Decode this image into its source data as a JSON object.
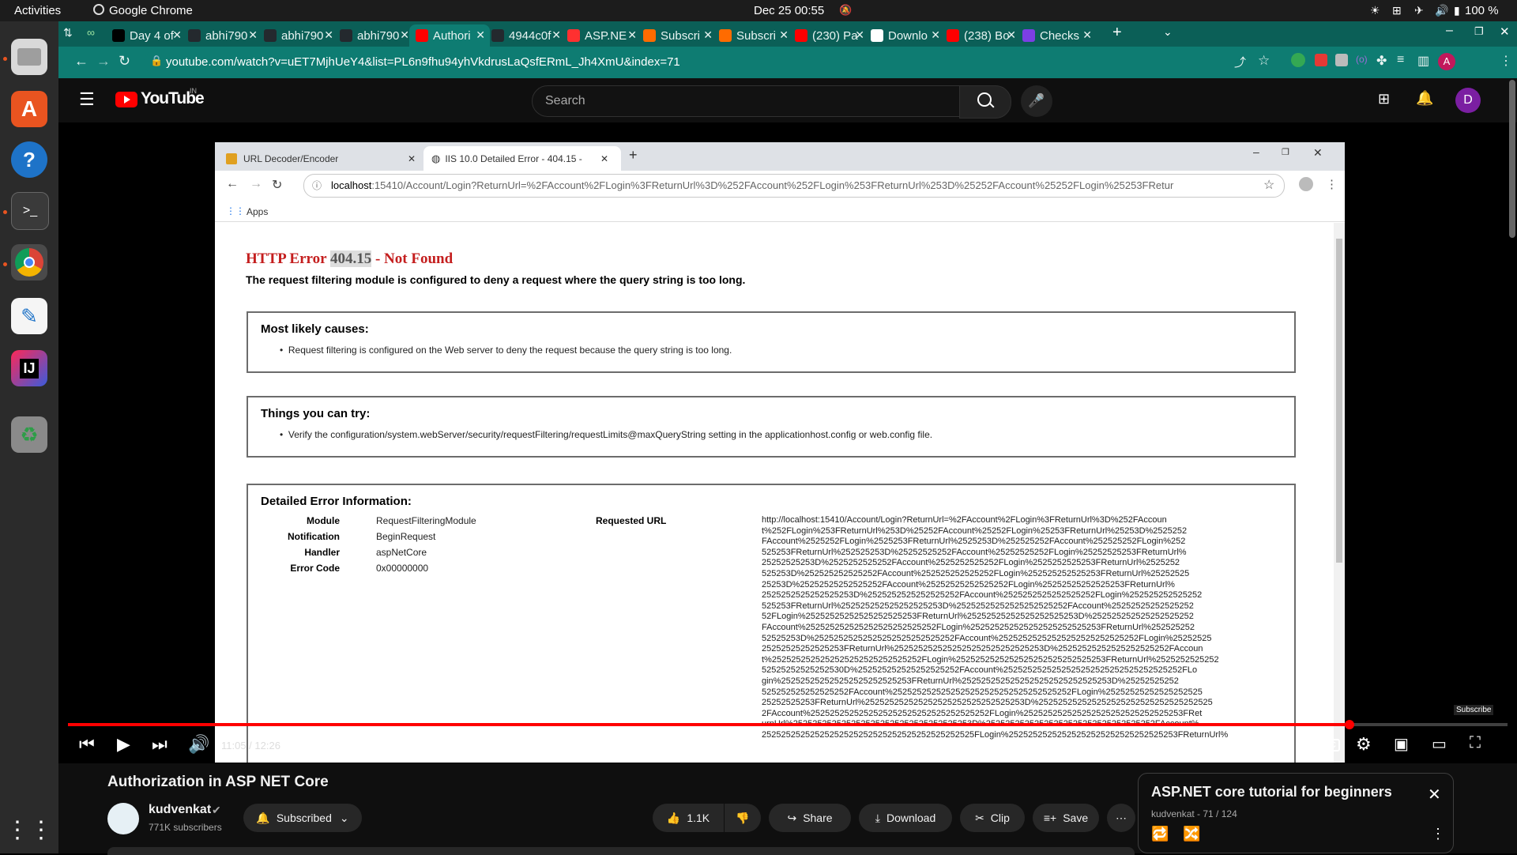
{
  "topbar": {
    "activities": "Activities",
    "app": "Google Chrome",
    "datetime": "Dec 25  00:55",
    "battery": "100 %"
  },
  "chrome": {
    "tabs": [
      {
        "label": "Day 4 of",
        "icon": "medium-icon",
        "color": "#000000"
      },
      {
        "label": "abhi790",
        "icon": "github-icon",
        "color": "#24292e"
      },
      {
        "label": "abhi790",
        "icon": "github-icon",
        "color": "#24292e"
      },
      {
        "label": "abhi790",
        "icon": "github-icon",
        "color": "#24292e"
      },
      {
        "label": "Authori",
        "icon": "youtube-icon",
        "color": "#ff0000",
        "active": true
      },
      {
        "label": "4944c0f",
        "icon": "github-icon",
        "color": "#24292e"
      },
      {
        "label": "ASP.NE",
        "icon": "dot-icon",
        "color": "#ff3030"
      },
      {
        "label": "Subscri",
        "icon": "loading-icon",
        "color": "#ff6b00"
      },
      {
        "label": "Subscri",
        "icon": "loading-icon",
        "color": "#ff6b00"
      },
      {
        "label": "(230) Pa",
        "icon": "youtube-icon",
        "color": "#ff0000"
      },
      {
        "label": "Downlo",
        "icon": "download-icon",
        "color": "#ffffff"
      },
      {
        "label": "(238) Bo",
        "icon": "youtube-icon",
        "color": "#ff0000"
      },
      {
        "label": "Checks",
        "icon": "letter-b-icon",
        "color": "#7b3fe4"
      }
    ],
    "url": "youtube.com/watch?v=uET7MjhUeY4&list=PL6n9fhu94yhVkdrusLaQsfERmL_Jh4XmU&index=71",
    "accent": "#0e7c72",
    "profile_letter": "A"
  },
  "youtube": {
    "logo": "YouTube",
    "region": "IN",
    "search_placeholder": "Search",
    "avatar_letter": "D",
    "video_title": "Authorization in ASP NET Core",
    "channel": "kudvenkat",
    "subscribers": "771K subscribers",
    "subscribed_label": "Subscribed",
    "likes": "1.1K",
    "share": "Share",
    "download": "Download",
    "clip": "Clip",
    "save": "Save",
    "time": "11:05 / 12:26",
    "progress": 0.89,
    "subscribe_watermark": "Subscribe",
    "playlist_title": "ASP.NET core tutorial for beginners",
    "playlist_meta": "kudvenkat - 71 / 124"
  },
  "inner": {
    "tab1": "URL Decoder/Encoder",
    "tab2": "IIS 10.0 Detailed Error - 404.15 -",
    "url_host": "localhost",
    "url_rest": ":15410/Account/Login?ReturnUrl=%2FAccount%2FLogin%3FReturnUrl%3D%252FAccount%252FLogin%253FReturnUrl%253D%25252FAccount%25252FLogin%25253FRetur",
    "apps": "Apps",
    "error_prefix": "HTTP Error ",
    "error_code": "404.15",
    "error_suffix": " - Not Found",
    "error_desc": "The request filtering module is configured to deny a request where the query string is too long.",
    "causes_title": "Most likely causes:",
    "causes_item": "Request filtering is configured on the Web server to deny the request because the query string is too long.",
    "try_title": "Things you can try:",
    "try_item": "Verify the configuration/system.webServer/security/requestFiltering/requestLimits@maxQueryString setting in the applicationhost.config or web.config file.",
    "detail_title": "Detailed Error Information:",
    "details": [
      {
        "k": "Module",
        "v": "RequestFilteringModule"
      },
      {
        "k": "Notification",
        "v": "BeginRequest"
      },
      {
        "k": "Handler",
        "v": "aspNetCore"
      },
      {
        "k": "Error Code",
        "v": "0x00000000"
      }
    ],
    "requested_url_label": "Requested URL",
    "requested_url_lines": [
      "http://localhost:15410/Account/Login?ReturnUrl=%2FAccount%2FLogin%3FReturnUrl%3D%252FAccoun",
      "t%252FLogin%253FReturnUrl%253D%25252FAccount%25252FLogin%25253FReturnUrl%25253D%2525252",
      "FAccount%2525252FLogin%2525253FReturnUrl%2525253D%252525252FAccount%252525252FLogin%252",
      "525253FReturnUrl%252525253D%25252525252FAccount%25252525252FLogin%25252525253FReturnUrl%",
      "25252525253D%2525252525252FAccount%2525252525252FLogin%2525252525253FReturnUrl%2525252",
      "525253D%252525252525252FAccount%252525252525252FLogin%252525252525253FReturnUrl%25252525",
      "25253D%25252525252525252FAccount%25252525252525252FLogin%25252525252525253FReturnUrl%",
      "2525252525252525253D%2525252525252525252FAccount%2525252525252525252FLogin%252525252525252",
      "525253FReturnUrl%252525252525252525253D%25252525252525252525252FAccount%25252525252525252",
      "52FLogin%25252525252525252525253FReturnUrl%25252525252525252525253D%252525252525252525252",
      "FAccount%252525252525252525252525252FLogin%252525252525252525252525253FReturnUrl%252525252",
      "52525253D%25252525252525252525252525252FAccount%25252525252525252525252525252FLogin%25252525",
      "25252525252525253FReturnUrl%2525252525252525252525252525253D%25252525252525252525252FAccoun",
      "t%2525252525252525252525252525252FLogin%2525252525252525252525252525253FReturnUrl%2525252525252",
      "52525252525252530D%252525252525252525252FAccount%2525252525252525252525252525252525252FLo",
      "gin%252525252525252525252525253FReturnUrl%2525252525252525252525252525253D%25252525252",
      "525252525252525252FAccount%2525252525252525252525252525252525252FLogin%25252525252525252525",
      "25252525253FReturnUrl%252525252525252525252525252525253D%252525252525252525252525252525252525",
      "2FAccount%2525252525252525252525252525252525252FLogin%252525252525252525252525252525253FRet",
      "urnUrl%2525252525252525252525252525252525253D%25252525252525252525252525252525252FAccount%",
      "25252525252525252525252525252525252525252525FLogin%25252525252525252525252525252525253FReturnUrl%"
    ]
  }
}
